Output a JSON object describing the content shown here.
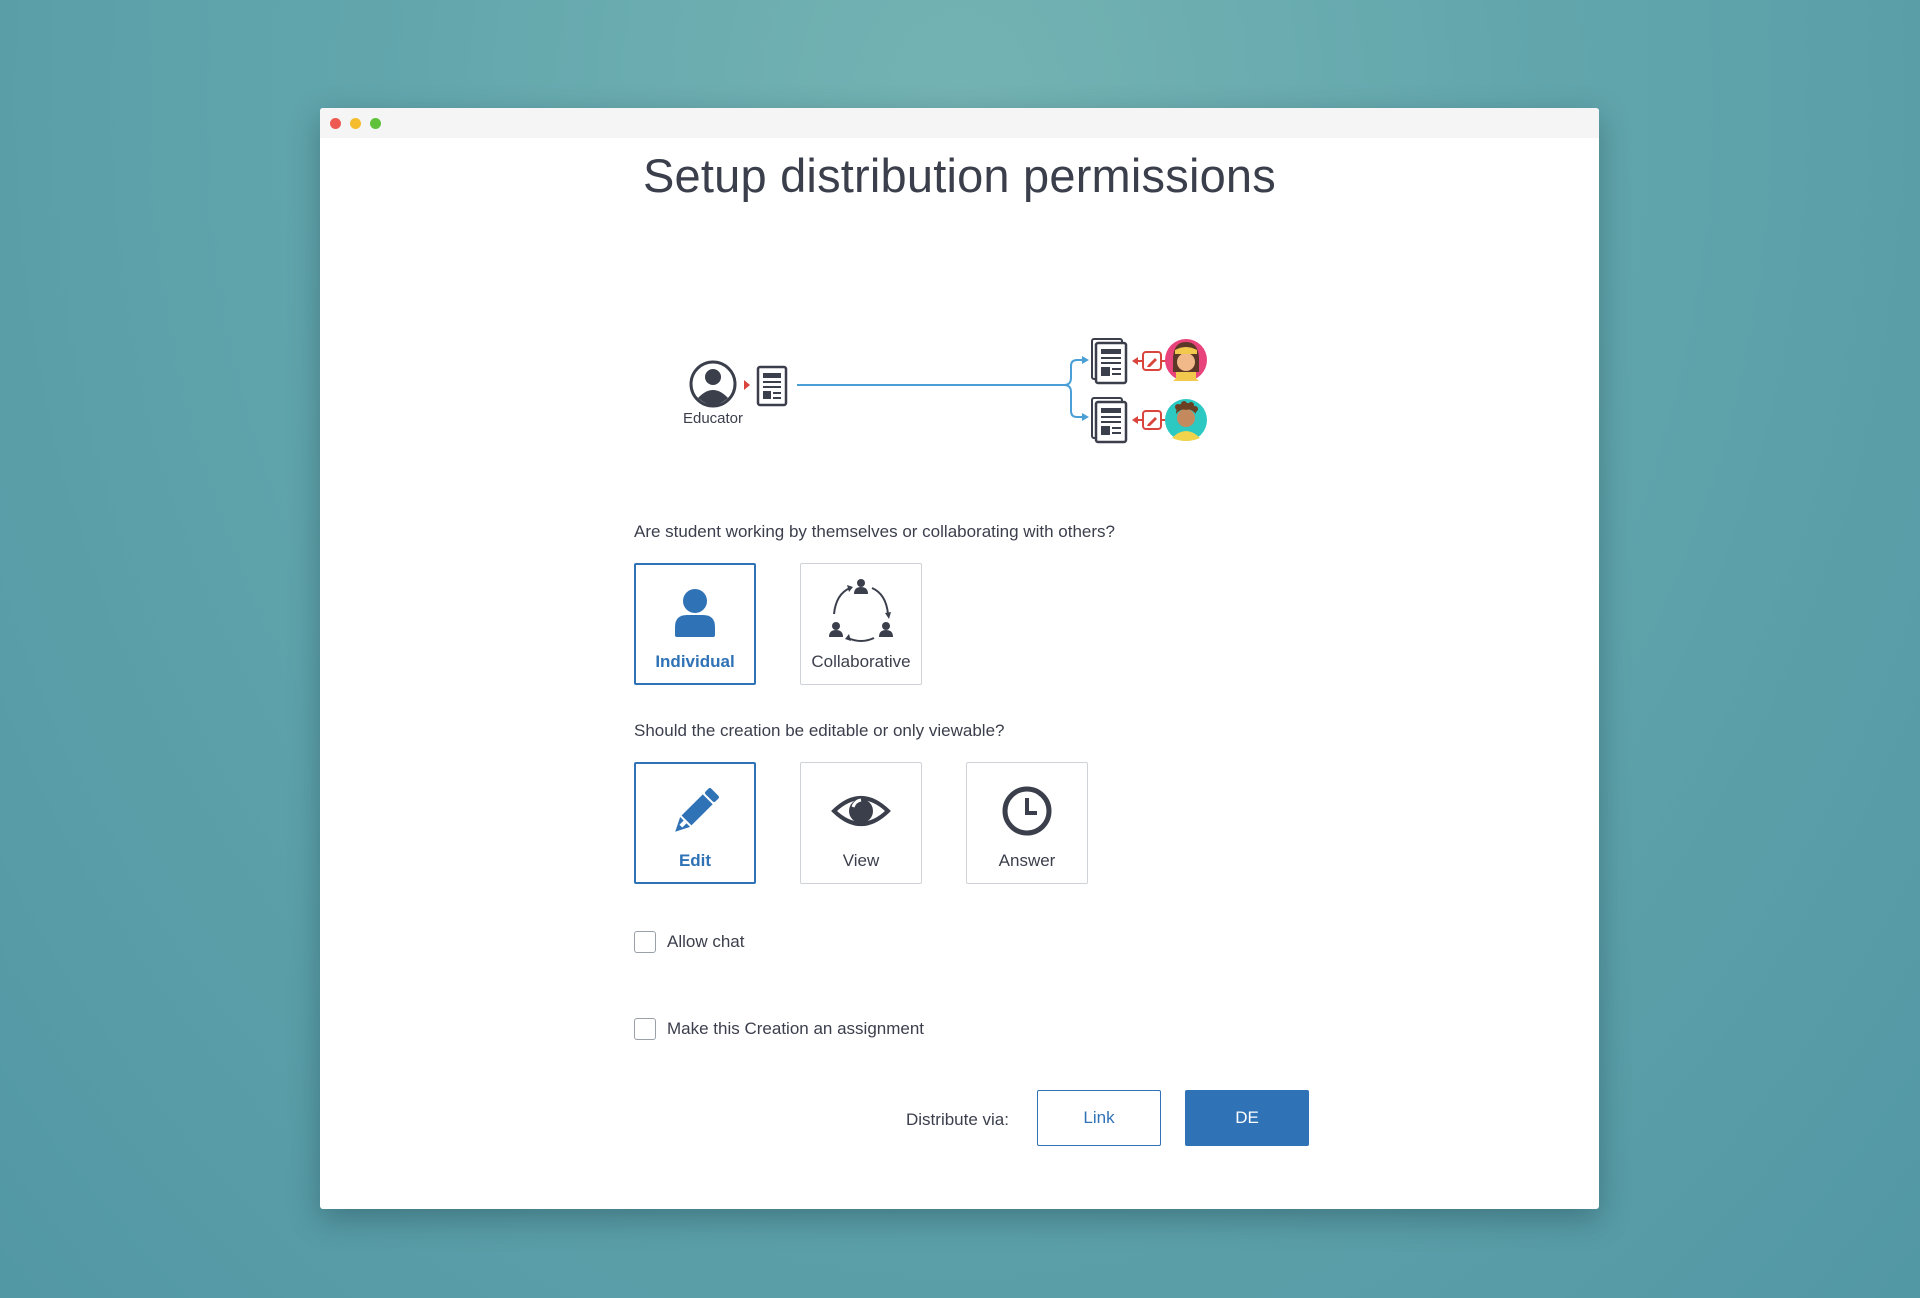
{
  "window": {
    "title": "Setup distribution permissions"
  },
  "diagram": {
    "educator_label": "Educator"
  },
  "work_mode": {
    "question": "Are student working by themselves or collaborating with others?",
    "options": [
      {
        "label": "Individual",
        "selected": true,
        "icon": "person-icon"
      },
      {
        "label": "Collaborative",
        "selected": false,
        "icon": "collaborative-cycle-icon"
      }
    ]
  },
  "permission": {
    "question": "Should the creation be editable or only viewable?",
    "options": [
      {
        "label": "Edit",
        "selected": true,
        "icon": "pencil-icon"
      },
      {
        "label": "View",
        "selected": false,
        "icon": "eye-icon"
      },
      {
        "label": "Answer",
        "selected": false,
        "icon": "clock-icon"
      }
    ]
  },
  "checkboxes": {
    "allow_chat": {
      "label": "Allow chat",
      "checked": false
    },
    "assignment": {
      "label": "Make this Creation an assignment",
      "checked": false
    }
  },
  "distribute": {
    "label": "Distribute via:",
    "link_button": "Link",
    "de_button": "DE"
  },
  "colors": {
    "accent": "#2f72b6",
    "diagram_line": "#4a9fd6",
    "arrow_red": "#d9443d",
    "dark_icon": "#3b3f4c"
  }
}
